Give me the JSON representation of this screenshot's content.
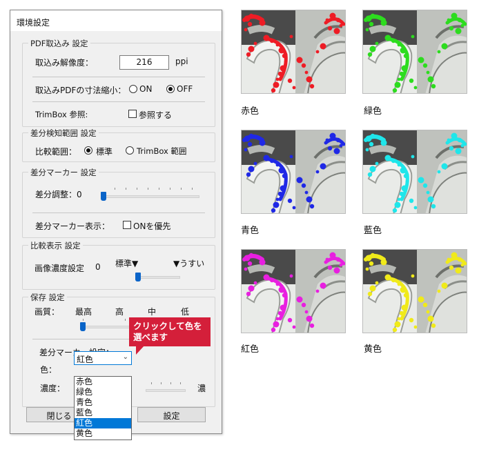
{
  "dialog": {
    "title": "環境設定",
    "pdf_group": {
      "legend": "PDF取込み 設定",
      "resolution_label": "取込み解像度：",
      "resolution_value": "216",
      "resolution_unit": "ppi",
      "shrink_label": "取込みPDFの寸法縮小：",
      "shrink_on": "ON",
      "shrink_off": "OFF",
      "trimbox_label": "TrimBox 参照:",
      "trimbox_check_label": "参照する"
    },
    "range_group": {
      "legend": "差分検知範囲 設定",
      "compare_label": "比較範囲：",
      "option_standard": "標準",
      "option_trimbox": "TrimBox 範囲"
    },
    "marker_group": {
      "legend": "差分マーカー 設定",
      "adjust_label": "差分調整：0",
      "display_label": "差分マーカー表示：",
      "display_check_label": "ONを優先"
    },
    "compare_display_group": {
      "legend": "比較表示 設定",
      "density_label": "画像濃度設定",
      "density_value": "0",
      "standard_mark": "標準▼",
      "light_mark": "▼うすい"
    },
    "save_group": {
      "legend": "保存 設定",
      "quality_label": "画質：",
      "quality_levels": [
        "最高",
        "高",
        "中",
        "低"
      ],
      "marker_setting_label": "差分マーカー設定：",
      "color_label": "色：",
      "color_selected": "紅色",
      "density_label": "濃度：",
      "density_right": "濃"
    },
    "color_options": [
      "赤色",
      "緑色",
      "青色",
      "藍色",
      "紅色",
      "黄色"
    ],
    "color_selected_index": 4,
    "buttons": {
      "close": "閉じる",
      "apply": "設定"
    },
    "callout": [
      "クリックして色を",
      "選べます"
    ]
  },
  "samples": [
    {
      "label": "赤色",
      "color": "#ee1c25"
    },
    {
      "label": "緑色",
      "color": "#2ddc1f"
    },
    {
      "label": "青色",
      "color": "#1f28e6"
    },
    {
      "label": "藍色",
      "color": "#1fe6ea"
    },
    {
      "label": "紅色",
      "color": "#e81fe0"
    },
    {
      "label": "黄色",
      "color": "#f0ea1a"
    }
  ],
  "colors": {
    "accent": "#0078d7",
    "slider_thumb": "#0a64c8",
    "callout": "#d41f3a"
  }
}
